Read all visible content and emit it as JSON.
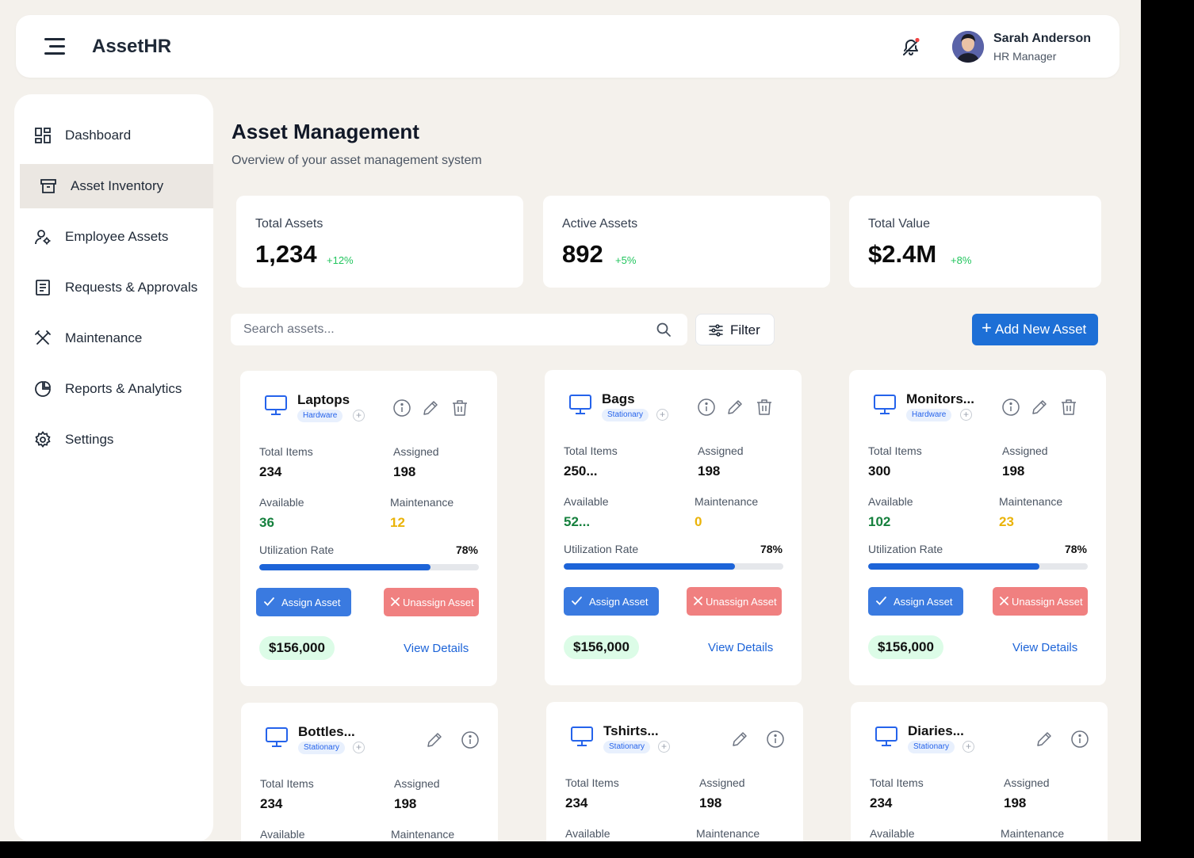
{
  "header": {
    "app_name": "AssetHR",
    "user_name": "Sarah Anderson",
    "user_role": "HR Manager",
    "notification_dot_color": "#ef4444"
  },
  "sidebar": {
    "items": [
      {
        "label": "Dashboard",
        "icon": "dashboard-icon"
      },
      {
        "label": "Asset Inventory",
        "icon": "archive-box-icon",
        "active": true
      },
      {
        "label": "Employee Assets",
        "icon": "user-gear-icon"
      },
      {
        "label": "Requests & Approvals",
        "icon": "document-icon"
      },
      {
        "label": "Maintenance",
        "icon": "tools-icon"
      },
      {
        "label": "Reports & Analytics",
        "icon": "pie-chart-icon"
      },
      {
        "label": "Settings",
        "icon": "gear-icon"
      }
    ]
  },
  "main": {
    "title": "Asset Management",
    "subtitle": "Overview of your asset management system",
    "stats": [
      {
        "label": "Total Assets",
        "value": "1,234",
        "delta": "+12%"
      },
      {
        "label": "Active Assets",
        "value": "892",
        "delta": "+5%"
      },
      {
        "label": "Total Value",
        "value": "$2.4M",
        "delta": "+8%"
      }
    ],
    "search_placeholder": "Search assets...",
    "filter_label": "Filter",
    "add_button_label": "Add New Asset",
    "card_labels": {
      "total_items": "Total Items",
      "assigned": "Assigned",
      "available": "Available",
      "maintenance": "Maintenance",
      "utilization": "Utilization Rate",
      "assign": "Assign Asset",
      "unassign": "Unassign Asset",
      "view_details": "View Details"
    },
    "cards": [
      {
        "name": "Laptops",
        "tag": "Hardware",
        "total_items": "234",
        "assigned": "198",
        "available": "36",
        "maintenance": "12",
        "utilization": "78%",
        "utilization_value": 0.78,
        "price": "$156,000"
      },
      {
        "name": "Bags",
        "tag": "Stationary",
        "total_items": "250...",
        "assigned": "198",
        "available": "52...",
        "maintenance": "0",
        "utilization": "78%",
        "utilization_value": 0.78,
        "price": "$156,000"
      },
      {
        "name": "Monitors...",
        "tag": "Hardware",
        "total_items": "300",
        "assigned": "198",
        "available": "102",
        "maintenance": "23",
        "utilization": "78%",
        "utilization_value": 0.78,
        "price": "$156,000"
      },
      {
        "name": "Bottles...",
        "tag": "Stationary",
        "total_items": "234",
        "assigned": "198"
      },
      {
        "name": "Tshirts...",
        "tag": "Stationary",
        "total_items": "234",
        "assigned": "198"
      },
      {
        "name": "Diaries...",
        "tag": "Stationary",
        "total_items": "234",
        "assigned": "198"
      }
    ]
  },
  "colors": {
    "accent": "#1d6fd6",
    "success": "#22c55e",
    "warning": "#eab308",
    "danger_button": "#f08080",
    "background": "#f4f1ec"
  }
}
